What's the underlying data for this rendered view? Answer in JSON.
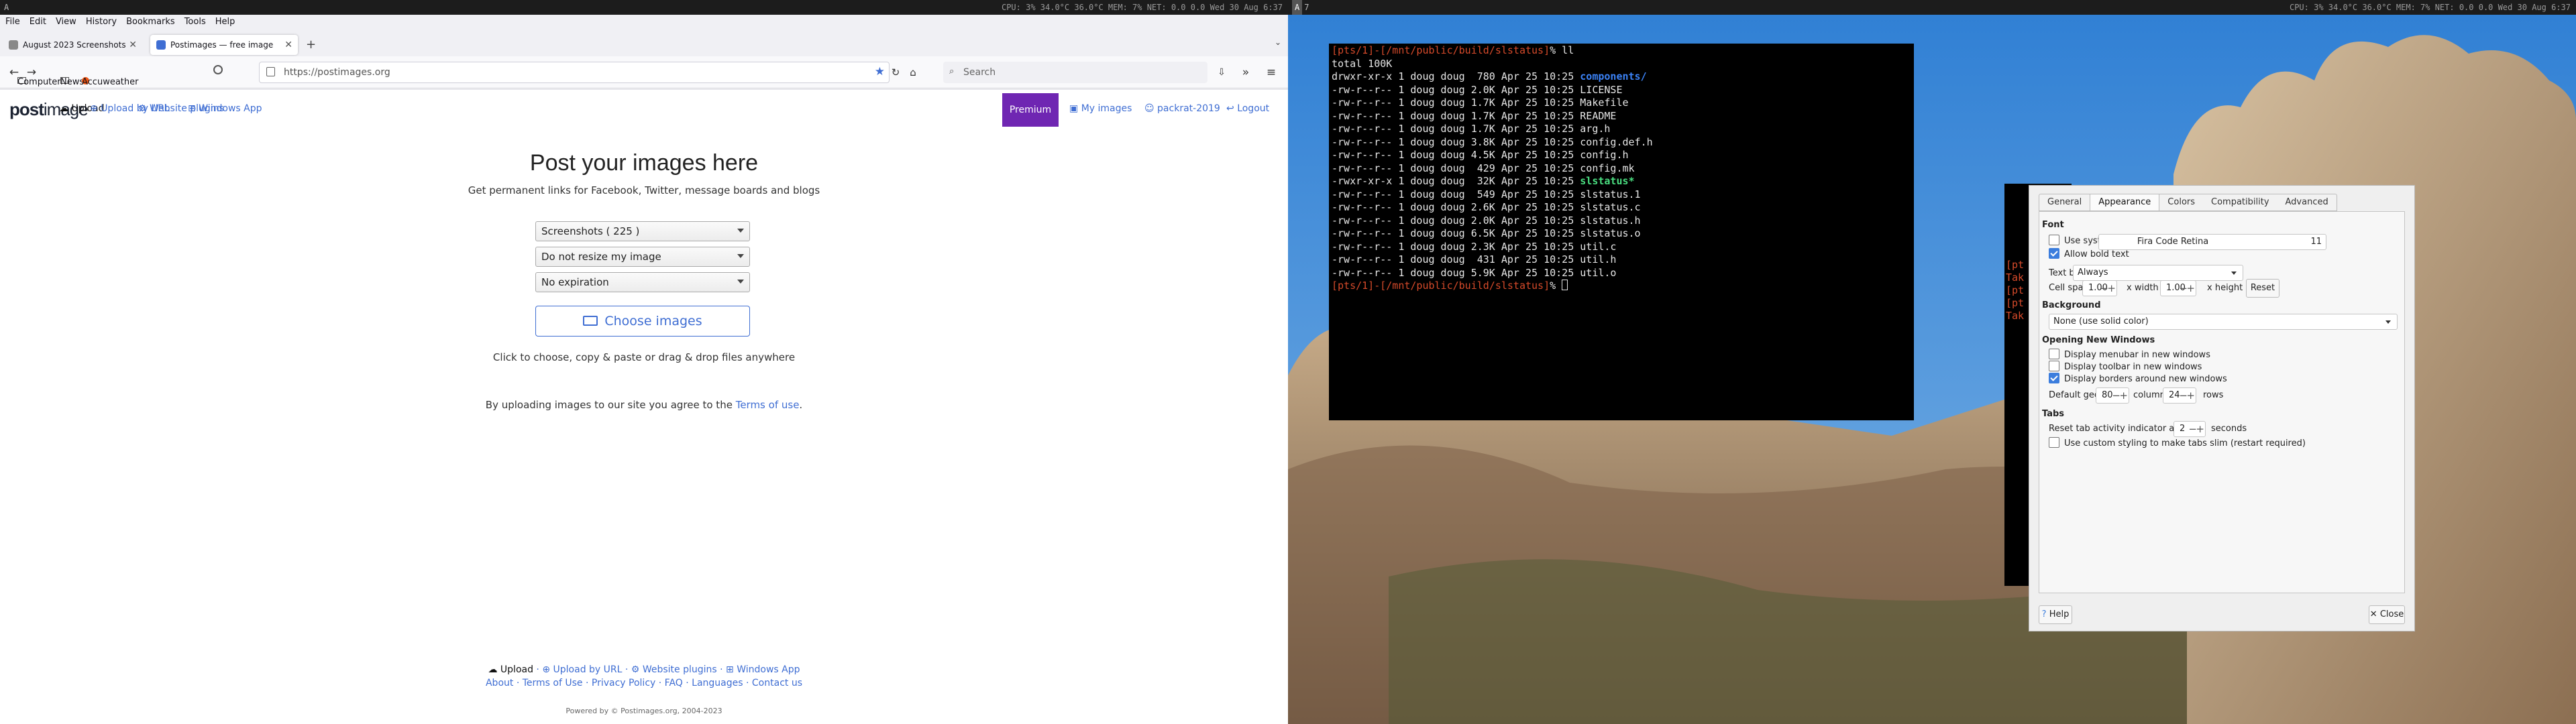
{
  "topbar": {
    "left_ws": "A",
    "right_ws_a": "A",
    "right_ws_b": "7",
    "stats": "CPU:   3%   34.0°C   36.0°C   MEM:   7%   NET:   0.0        0.0     Wed  30 Aug   6:37"
  },
  "firefox": {
    "menu": [
      "File",
      "Edit",
      "View",
      "History",
      "Bookmarks",
      "Tools",
      "Help"
    ],
    "tabs": [
      {
        "label": "August 2023 Screenshots",
        "icon_color": "#888888"
      },
      {
        "label": "Postimages — free image",
        "icon_color": "#3f6ed3"
      }
    ],
    "url": "https://postimages.org",
    "search_placeholder": "Search",
    "bookmarks": [
      "Computer",
      "News",
      "Accuweather"
    ]
  },
  "site": {
    "logo_a": "post",
    "logo_b": "image",
    "nav": {
      "upload": "Upload",
      "upload_url": "Upload by URL",
      "plugins": "Website plugins",
      "windows_app": "Windows App",
      "premium": "Premium",
      "my_images": "My images",
      "user": "packrat-2019",
      "logout": "Logout"
    },
    "title": "Post your images here",
    "subtitle": "Get permanent links for Facebook, Twitter, message boards and blogs",
    "selects": [
      "Screenshots ( 225 )",
      "Do not resize my image",
      "No expiration"
    ],
    "choose": "Choose images",
    "hint": "Click to choose, copy & paste or drag & drop files anywhere",
    "terms_prefix": "By uploading images to our site you agree to the ",
    "terms_link": "Terms of use",
    "terms_suffix": ".",
    "footer1": {
      "upload": "Upload",
      "upload_url": "Upload by URL",
      "plugins": "Website plugins",
      "windows_app": "Windows App"
    },
    "footer2": [
      "About",
      "Terms of Use",
      "Privacy Policy",
      "FAQ",
      "Languages",
      "Contact us"
    ],
    "powered": "Powered by © Postimages.org, 2004-2023"
  },
  "terminal": {
    "prompt": "[pts/1]-[/mnt/public/build/slstatus]",
    "cmd": "% ll",
    "total": "total 100K",
    "lines": [
      {
        "meta": "drwxr-xr-x 1 doug doug  780 Apr 25 10:25 ",
        "name": "components/",
        "cls": "blue"
      },
      {
        "meta": "-rw-r--r-- 1 doug doug 2.0K Apr 25 10:25 ",
        "name": "LICENSE",
        "cls": ""
      },
      {
        "meta": "-rw-r--r-- 1 doug doug 1.7K Apr 25 10:25 ",
        "name": "Makefile",
        "cls": ""
      },
      {
        "meta": "-rw-r--r-- 1 doug doug 1.7K Apr 25 10:25 ",
        "name": "README",
        "cls": ""
      },
      {
        "meta": "-rw-r--r-- 1 doug doug 1.7K Apr 25 10:25 ",
        "name": "arg.h",
        "cls": ""
      },
      {
        "meta": "-rw-r--r-- 1 doug doug 3.8K Apr 25 10:25 ",
        "name": "config.def.h",
        "cls": ""
      },
      {
        "meta": "-rw-r--r-- 1 doug doug 4.5K Apr 25 10:25 ",
        "name": "config.h",
        "cls": ""
      },
      {
        "meta": "-rw-r--r-- 1 doug doug  429 Apr 25 10:25 ",
        "name": "config.mk",
        "cls": ""
      },
      {
        "meta": "-rwxr-xr-x 1 doug doug  32K Apr 25 10:25 ",
        "name": "slstatus*",
        "cls": "grn"
      },
      {
        "meta": "-rw-r--r-- 1 doug doug  549 Apr 25 10:25 ",
        "name": "slstatus.1",
        "cls": ""
      },
      {
        "meta": "-rw-r--r-- 1 doug doug 2.6K Apr 25 10:25 ",
        "name": "slstatus.c",
        "cls": ""
      },
      {
        "meta": "-rw-r--r-- 1 doug doug 2.0K Apr 25 10:25 ",
        "name": "slstatus.h",
        "cls": ""
      },
      {
        "meta": "-rw-r--r-- 1 doug doug 6.5K Apr 25 10:25 ",
        "name": "slstatus.o",
        "cls": ""
      },
      {
        "meta": "-rw-r--r-- 1 doug doug 2.3K Apr 25 10:25 ",
        "name": "util.c",
        "cls": ""
      },
      {
        "meta": "-rw-r--r-- 1 doug doug  431 Apr 25 10:25 ",
        "name": "util.h",
        "cls": ""
      },
      {
        "meta": "-rw-r--r-- 1 doug doug 5.9K Apr 25 10:25 ",
        "name": "util.o",
        "cls": ""
      }
    ],
    "back_lines": "[pt\nTak\n[pt\n[pt\nTak"
  },
  "prefs": {
    "tabs": [
      "General",
      "Appearance",
      "Colors",
      "Compatibility",
      "Advanced"
    ],
    "font_section": "Font",
    "use_system_font": "Use system font",
    "font_name": "Fira Code Retina",
    "font_size": "11",
    "allow_bold": "Allow bold text",
    "text_blinks_label": "Text blinks:",
    "text_blinks_value": "Always",
    "cell_spacing_label": "Cell spacing:",
    "cell_w": "1.00",
    "x_width": "x width",
    "cell_h": "1.00",
    "x_height": "x height",
    "reset": "Reset",
    "bg_section": "Background",
    "bg_value": "None (use solid color)",
    "new_windows_section": "Opening New Windows",
    "menubar_opt": "Display menubar in new windows",
    "toolbar_opt": "Display toolbar in new windows",
    "borders_opt": "Display borders around new windows",
    "geometry_label": "Default geometry:",
    "cols": "80",
    "columns": "columns",
    "rows_val": "24",
    "rows": "rows",
    "tabs_section": "Tabs",
    "reset_tab_label": "Reset tab activity indicator after",
    "reset_tab_val": "2",
    "seconds": "seconds",
    "custom_tabs": "Use custom styling to make tabs slim (restart required)",
    "help": "Help",
    "close": "Close"
  }
}
